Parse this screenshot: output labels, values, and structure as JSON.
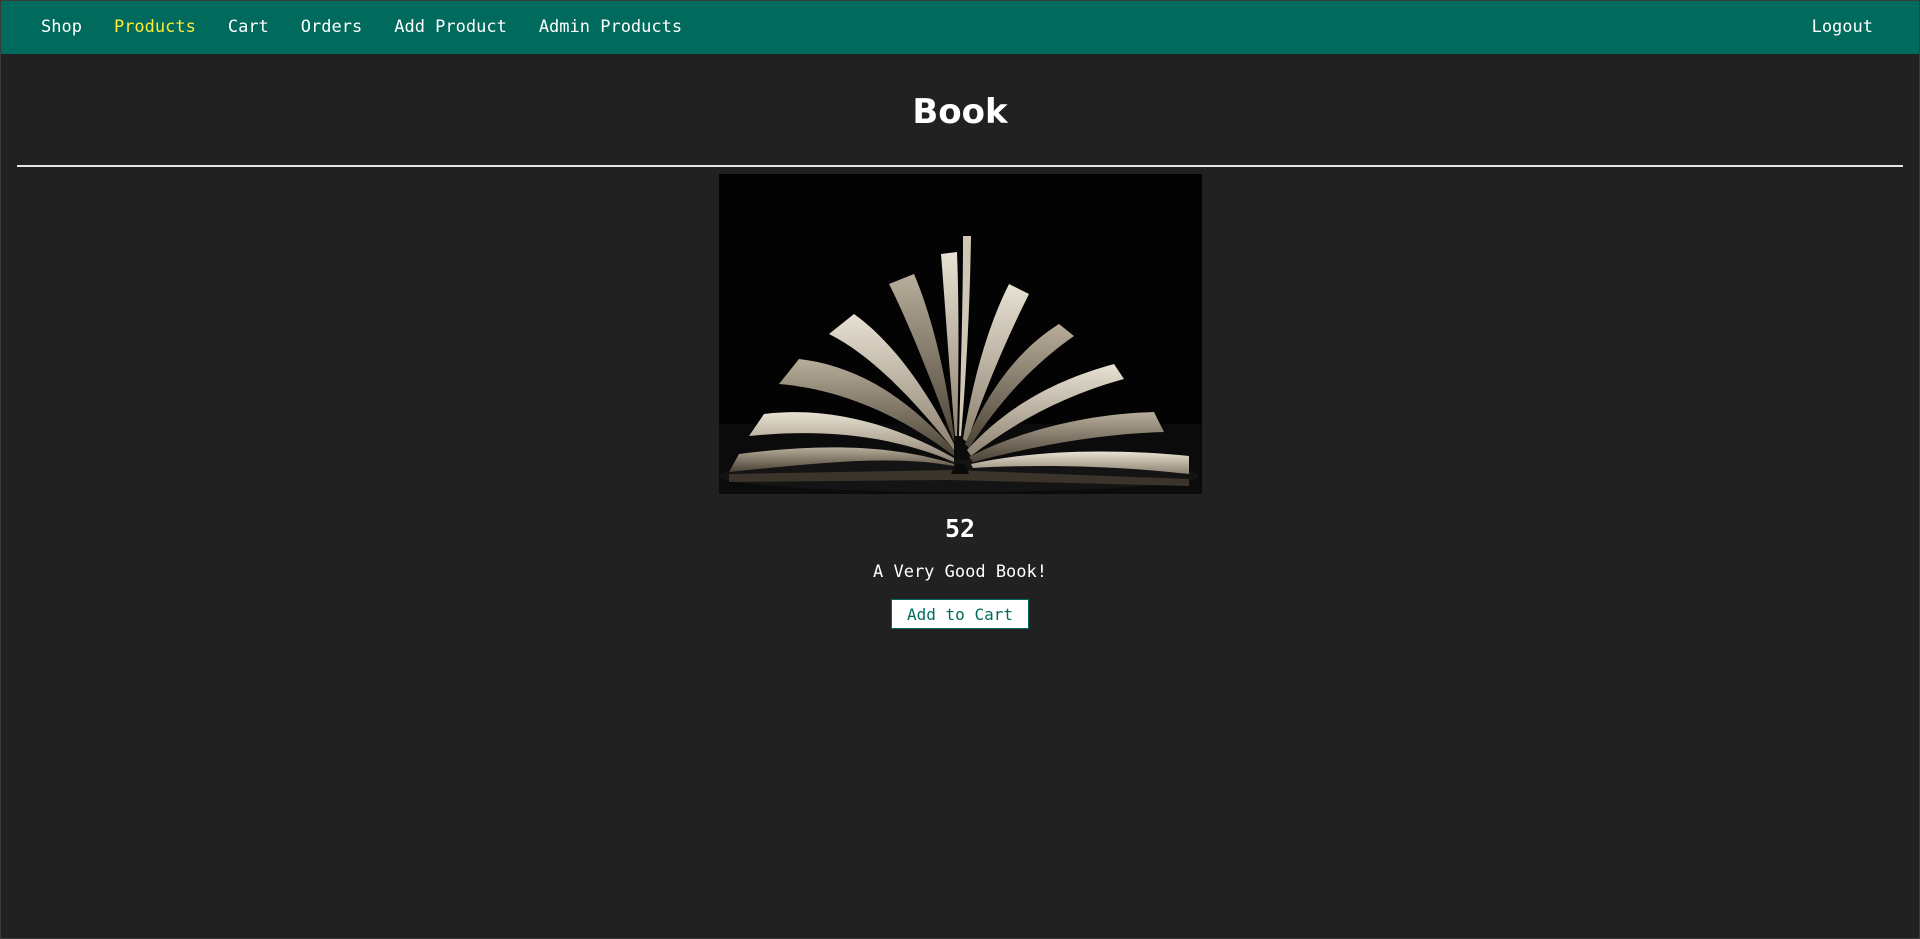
{
  "nav": {
    "items": [
      {
        "label": "Shop",
        "active": false
      },
      {
        "label": "Products",
        "active": true
      },
      {
        "label": "Cart",
        "active": false
      },
      {
        "label": "Orders",
        "active": false
      },
      {
        "label": "Add Product",
        "active": false
      },
      {
        "label": "Admin Products",
        "active": false
      }
    ],
    "logout_label": "Logout"
  },
  "product": {
    "title": "Book",
    "image_alt": "Open book",
    "price": "52",
    "description": "A Very Good Book!",
    "add_to_cart_label": "Add to Cart"
  },
  "colors": {
    "header_bg": "#006b5c",
    "active_link": "#ffeb3b",
    "page_bg": "#212121"
  }
}
